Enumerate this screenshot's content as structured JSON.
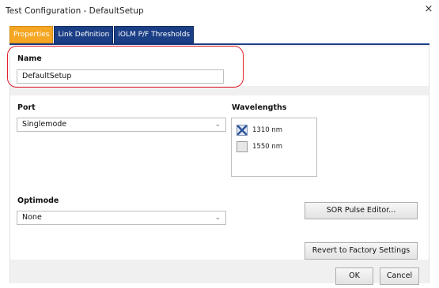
{
  "window": {
    "title": "Test Configuration - DefaultSetup",
    "close_glyph": "×"
  },
  "tabs": [
    {
      "label": "Properties",
      "active": true
    },
    {
      "label": "Link Definition",
      "active": false
    },
    {
      "label": "iOLM P/F Thresholds",
      "active": false
    }
  ],
  "name_section": {
    "label": "Name",
    "value": "DefaultSetup"
  },
  "port": {
    "label": "Port",
    "selected": "Singlemode"
  },
  "wavelengths": {
    "label": "Wavelengths",
    "items": [
      {
        "label": "1310 nm",
        "checked": true
      },
      {
        "label": "1550 nm",
        "checked": false
      }
    ]
  },
  "optimode": {
    "label": "Optimode",
    "selected": "None"
  },
  "buttons": {
    "sor_pulse_editor": "SOR Pulse Editor...",
    "revert": "Revert to Factory Settings",
    "ok": "OK",
    "cancel": "Cancel"
  },
  "icons": {
    "dropdown": "chevron-down-icon",
    "close": "close-icon",
    "check": "x-check-icon"
  },
  "colors": {
    "tab_active": "#f5a623",
    "tab_inactive": "#1b3f86",
    "highlight": "#e0202a",
    "panel_bg": "#f0f0f0"
  }
}
